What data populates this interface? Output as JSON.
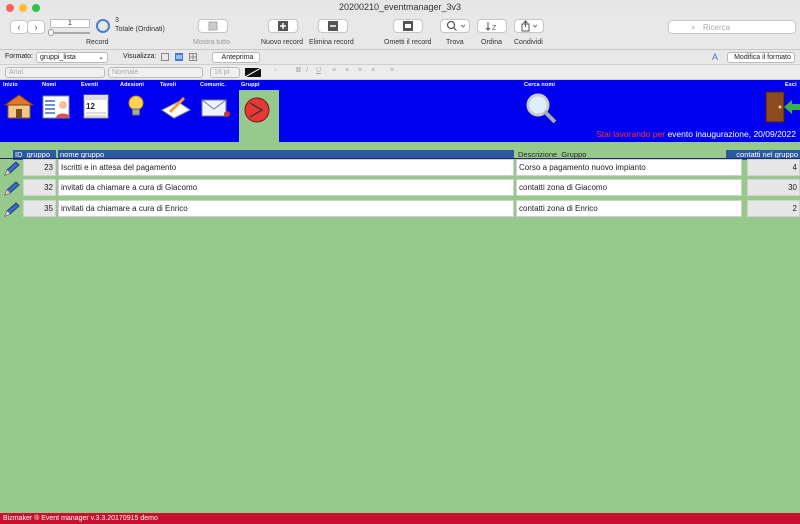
{
  "window": {
    "title": "20200210_eventmanager_3v3"
  },
  "toolbar": {
    "record_value": "1",
    "record_count": "3",
    "record_total_label": "Totale (Ordinati)",
    "record_label": "Record",
    "show_all": "Mostra tutto",
    "new_record": "Nuovo record",
    "delete_record": "Elimina record",
    "omit_record": "Ometti il record",
    "find": "Trova",
    "sort": "Ordina",
    "share": "Condividi",
    "search_placeholder": "Ricerca"
  },
  "formatbar": {
    "format_label": "Formato:",
    "format_value": "gruppi_lista",
    "view_label": "Visualizza:",
    "preview_button": "Anteprima",
    "modify_format": "Modifica il formato"
  },
  "fontbar": {
    "font": "Arial",
    "style": "Normale",
    "size": "16 pt"
  },
  "nav": {
    "inizio": "Inizio",
    "nomi": "Nomi",
    "eventi": "Eventi",
    "adesioni": "Adesioni",
    "tavoli": "Tavoli",
    "comunic": "Comunic.",
    "gruppi": "Gruppi",
    "cerca_nomi": "Cerca nomi",
    "esci": "Esci",
    "calendar_day": "12"
  },
  "status": {
    "prefix": "Stai lavorando per",
    "text": "evento inaugurazione, 20/09/2022"
  },
  "columns": {
    "id": "ID_gruppo",
    "name": "nome gruppo",
    "desc": "Descrizione_Gruppo",
    "contacts": "contatti nel gruppo"
  },
  "rows": [
    {
      "id": "23",
      "name": "Iscritti e in attesa del pagamento",
      "desc": "Corso a pagamento nuovo impianto",
      "contacts": "4"
    },
    {
      "id": "32",
      "name": "invitati da chiamare a cura di Giacomo",
      "desc": "contatti zona di Giacomo",
      "contacts": "30"
    },
    {
      "id": "35",
      "name": "invitati da chiamare a cura di Enrico",
      "desc": "contatti zona di Enrico",
      "contacts": "2"
    }
  ],
  "footer": {
    "text": "Bizmaker ® Event manager v.3.3.20170915 demo"
  },
  "colors": {
    "header_bg": "#0000f0",
    "body_bg": "#98c98c",
    "footer_bg": "#c8102e",
    "status_accent": "#ff3030"
  }
}
